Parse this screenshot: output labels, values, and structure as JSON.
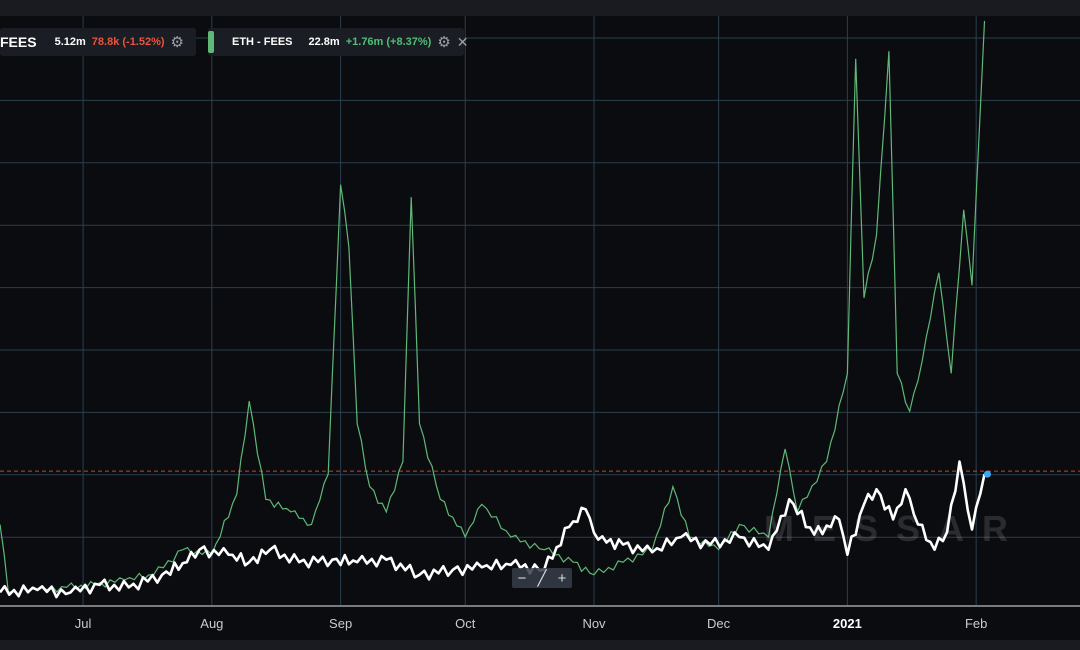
{
  "legend": {
    "left": {
      "name": "FEES",
      "value": "5.12m",
      "change": "78.8k (-1.52%)",
      "icon": "gear-icon"
    },
    "right": {
      "name": "ETH - FEES",
      "value": "22.8m",
      "change": "+1.76m (+8.37%)",
      "icons": [
        "gear-icon",
        "close-icon"
      ]
    }
  },
  "watermark": "MESSAR",
  "zoom": {
    "minus": "−",
    "slash": "╱",
    "plus": "+"
  },
  "colors": {
    "background": "#0b0c0f",
    "grid": "#2a3f4d",
    "green_series": "#5fb878",
    "white_series": "#ffffff",
    "reference_line": "#c4482f",
    "endpoint_dot": "#3aa7f0"
  },
  "chart_data": {
    "type": "line",
    "x_tick_labels": [
      "Jul",
      "Aug",
      "Sep",
      "Oct",
      "Nov",
      "Dec",
      "2021",
      "Feb"
    ],
    "x_tick_dates": [
      "2020-07-01",
      "2020-08-01",
      "2020-09-01",
      "2020-10-01",
      "2020-11-01",
      "2020-12-01",
      "2021-01-01",
      "2021-02-01"
    ],
    "x_range": [
      "2020-06-11",
      "2021-02-26"
    ],
    "y_range": [
      0,
      23.2
    ],
    "grid": true,
    "reference_line_value": 5.12,
    "series": [
      {
        "name": "ETH - FEES",
        "values": [
          {
            "x": "2020-06-11",
            "y": 3.0
          },
          {
            "x": "2020-06-13",
            "y": 0.3
          },
          {
            "x": "2020-06-20",
            "y": 0.4
          },
          {
            "x": "2020-06-27",
            "y": 0.5
          },
          {
            "x": "2020-07-04",
            "y": 0.6
          },
          {
            "x": "2020-07-11",
            "y": 0.8
          },
          {
            "x": "2020-07-18",
            "y": 1.0
          },
          {
            "x": "2020-07-25",
            "y": 2.0
          },
          {
            "x": "2020-08-01",
            "y": 1.8
          },
          {
            "x": "2020-08-07",
            "y": 4.2
          },
          {
            "x": "2020-08-10",
            "y": 7.9
          },
          {
            "x": "2020-08-14",
            "y": 4.0
          },
          {
            "x": "2020-08-20",
            "y": 3.5
          },
          {
            "x": "2020-08-25",
            "y": 3.0
          },
          {
            "x": "2020-08-29",
            "y": 5.0
          },
          {
            "x": "2020-09-01",
            "y": 16.5
          },
          {
            "x": "2020-09-03",
            "y": 14.0
          },
          {
            "x": "2020-09-05",
            "y": 7.0
          },
          {
            "x": "2020-09-08",
            "y": 4.5
          },
          {
            "x": "2020-09-12",
            "y": 3.5
          },
          {
            "x": "2020-09-16",
            "y": 5.5
          },
          {
            "x": "2020-09-18",
            "y": 16.0
          },
          {
            "x": "2020-09-20",
            "y": 7.0
          },
          {
            "x": "2020-09-25",
            "y": 4.0
          },
          {
            "x": "2020-10-01",
            "y": 2.5
          },
          {
            "x": "2020-10-05",
            "y": 3.8
          },
          {
            "x": "2020-10-12",
            "y": 2.5
          },
          {
            "x": "2020-10-20",
            "y": 2.0
          },
          {
            "x": "2020-10-27",
            "y": 1.5
          },
          {
            "x": "2020-11-01",
            "y": 1.0
          },
          {
            "x": "2020-11-08",
            "y": 1.5
          },
          {
            "x": "2020-11-15",
            "y": 2.0
          },
          {
            "x": "2020-11-20",
            "y": 4.5
          },
          {
            "x": "2020-11-24",
            "y": 2.5
          },
          {
            "x": "2020-12-01",
            "y": 2.0
          },
          {
            "x": "2020-12-06",
            "y": 3.0
          },
          {
            "x": "2020-12-13",
            "y": 2.5
          },
          {
            "x": "2020-12-17",
            "y": 6.0
          },
          {
            "x": "2020-12-20",
            "y": 3.5
          },
          {
            "x": "2020-12-27",
            "y": 5.5
          },
          {
            "x": "2021-01-01",
            "y": 9.0
          },
          {
            "x": "2021-01-03",
            "y": 21.5
          },
          {
            "x": "2021-01-05",
            "y": 12.0
          },
          {
            "x": "2021-01-08",
            "y": 14.5
          },
          {
            "x": "2021-01-11",
            "y": 21.8
          },
          {
            "x": "2021-01-13",
            "y": 9.0
          },
          {
            "x": "2021-01-16",
            "y": 7.5
          },
          {
            "x": "2021-01-19",
            "y": 9.5
          },
          {
            "x": "2021-01-23",
            "y": 13.0
          },
          {
            "x": "2021-01-26",
            "y": 9.0
          },
          {
            "x": "2021-01-29",
            "y": 15.5
          },
          {
            "x": "2021-01-31",
            "y": 12.5
          },
          {
            "x": "2021-02-03",
            "y": 23.0
          }
        ]
      },
      {
        "name": "FEES",
        "values": [
          {
            "x": "2020-06-11",
            "y": 0.3
          },
          {
            "x": "2020-06-20",
            "y": 0.4
          },
          {
            "x": "2020-06-28",
            "y": 0.3
          },
          {
            "x": "2020-07-05",
            "y": 0.6
          },
          {
            "x": "2020-07-12",
            "y": 0.5
          },
          {
            "x": "2020-07-20",
            "y": 1.0
          },
          {
            "x": "2020-07-26",
            "y": 1.5
          },
          {
            "x": "2020-07-29",
            "y": 2.0
          },
          {
            "x": "2020-08-05",
            "y": 1.8
          },
          {
            "x": "2020-08-10",
            "y": 1.5
          },
          {
            "x": "2020-08-15",
            "y": 2.0
          },
          {
            "x": "2020-08-22",
            "y": 1.5
          },
          {
            "x": "2020-08-30",
            "y": 1.6
          },
          {
            "x": "2020-09-05",
            "y": 1.5
          },
          {
            "x": "2020-09-12",
            "y": 1.6
          },
          {
            "x": "2020-09-20",
            "y": 1.0
          },
          {
            "x": "2020-09-28",
            "y": 1.2
          },
          {
            "x": "2020-10-05",
            "y": 1.3
          },
          {
            "x": "2020-10-12",
            "y": 1.4
          },
          {
            "x": "2020-10-20",
            "y": 1.2
          },
          {
            "x": "2020-10-26",
            "y": 2.9
          },
          {
            "x": "2020-10-30",
            "y": 3.6
          },
          {
            "x": "2020-11-02",
            "y": 2.4
          },
          {
            "x": "2020-11-08",
            "y": 2.2
          },
          {
            "x": "2020-11-15",
            "y": 1.9
          },
          {
            "x": "2020-11-22",
            "y": 2.5
          },
          {
            "x": "2020-11-29",
            "y": 2.2
          },
          {
            "x": "2020-12-06",
            "y": 2.5
          },
          {
            "x": "2020-12-13",
            "y": 2.0
          },
          {
            "x": "2020-12-18",
            "y": 4.0
          },
          {
            "x": "2020-12-24",
            "y": 2.6
          },
          {
            "x": "2020-12-30",
            "y": 3.2
          },
          {
            "x": "2021-01-01",
            "y": 1.8
          },
          {
            "x": "2021-01-05",
            "y": 3.8
          },
          {
            "x": "2021-01-08",
            "y": 4.4
          },
          {
            "x": "2021-01-12",
            "y": 3.2
          },
          {
            "x": "2021-01-15",
            "y": 4.4
          },
          {
            "x": "2021-01-18",
            "y": 3.0
          },
          {
            "x": "2021-01-22",
            "y": 2.0
          },
          {
            "x": "2021-01-25",
            "y": 2.7
          },
          {
            "x": "2021-01-28",
            "y": 5.5
          },
          {
            "x": "2021-01-31",
            "y": 2.8
          },
          {
            "x": "2021-02-03",
            "y": 5.0
          }
        ]
      }
    ]
  }
}
